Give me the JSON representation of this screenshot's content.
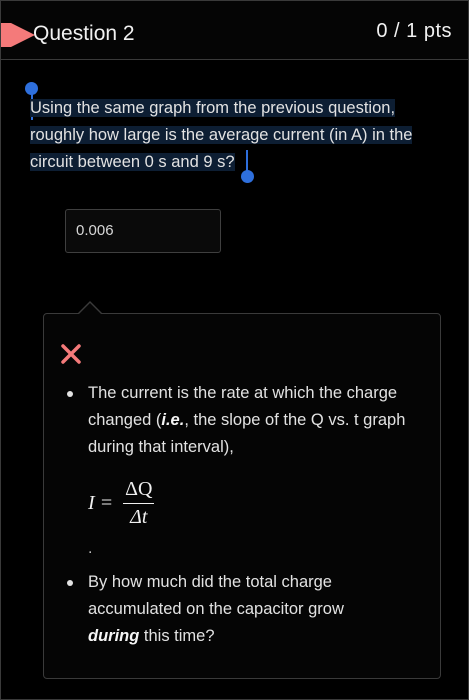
{
  "header": {
    "title": "Question 2",
    "points": "0 / 1 pts"
  },
  "question": {
    "text": "Using the same graph from the previous question, roughly how large is the average current (in A) in the circuit between 0 s and 9 s?"
  },
  "answer": {
    "value": "0.006"
  },
  "feedback": {
    "bullet1_part1": "The current is the rate at which the charge changed (",
    "bullet1_emph": "i.e.",
    "bullet1_part2": ", the slope of the Q vs. t graph during that interval),",
    "formula_lhs": "I =",
    "formula_num": "ΔQ",
    "formula_den": "Δt",
    "period": ".",
    "bullet2_part1": "By how much did the total charge accumulated on the capacitor grow ",
    "bullet2_emph": "during",
    "bullet2_part2": " this time?"
  },
  "colors": {
    "flag": "#f47a7a",
    "incorrect_x": "#f47a7a",
    "selection_handle": "#2e6fdc"
  }
}
